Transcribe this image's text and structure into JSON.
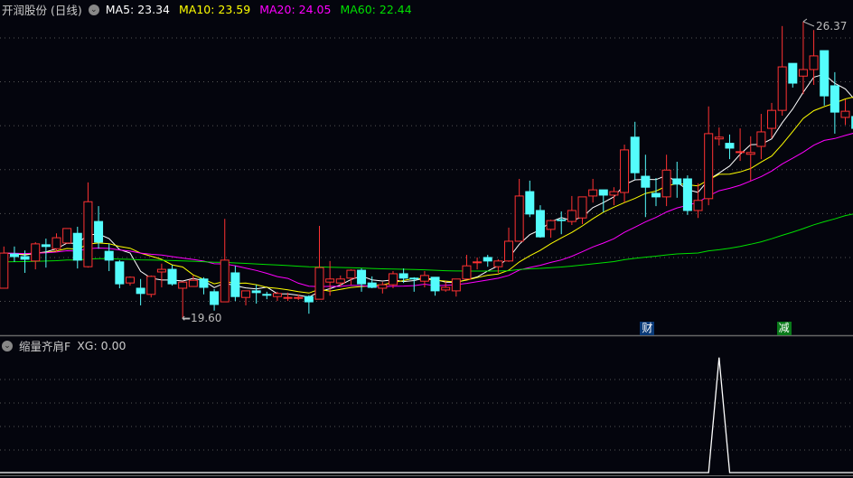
{
  "header": {
    "stock_name": "开润股份 (日线)",
    "ma_labels": [
      {
        "text": "MA5: 23.34",
        "color": "#ffffff"
      },
      {
        "text": "MA10: 23.59",
        "color": "#ffff00"
      },
      {
        "text": "MA20: 24.05",
        "color": "#ff00ff"
      },
      {
        "text": "MA60: 22.44",
        "color": "#00e000"
      }
    ]
  },
  "indicator": {
    "name": "缩量齐肩F",
    "value_label": "XG: 0.00"
  },
  "annotations": {
    "low_label": "←19.60",
    "high_label": "26.37",
    "event_tags": [
      {
        "text": "财",
        "index": 61,
        "color": "#0a3a78"
      },
      {
        "text": "减",
        "index": 74,
        "color": "#0a7a1a"
      }
    ]
  },
  "colors": {
    "up": "#ff3232",
    "down": "#54fcfc",
    "background": "#04050d",
    "grid": "#555555"
  },
  "chart_data": [
    {
      "type": "candlestick",
      "title": "开润股份 (日线)",
      "ylim": [
        19.4,
        27.0
      ],
      "grid": true,
      "ohlc": [
        [
          20.3,
          21.1,
          21.25,
          20.3
        ],
        [
          21.08,
          21.02,
          21.25,
          20.9
        ],
        [
          21.02,
          20.96,
          21.16,
          20.65
        ],
        [
          20.92,
          21.31,
          21.35,
          20.73
        ],
        [
          21.29,
          21.25,
          21.43,
          20.77
        ],
        [
          21.2,
          21.45,
          21.55,
          21.12
        ],
        [
          21.33,
          21.66,
          21.66,
          21.31
        ],
        [
          21.55,
          20.94,
          21.7,
          20.75
        ],
        [
          20.79,
          22.27,
          22.71,
          20.77
        ],
        [
          21.82,
          21.35,
          22.17,
          21.2
        ],
        [
          21.14,
          20.94,
          21.31,
          20.69
        ],
        [
          20.9,
          20.4,
          20.94,
          20.3
        ],
        [
          20.42,
          20.55,
          20.57,
          20.36
        ],
        [
          20.3,
          20.18,
          20.51,
          19.91
        ],
        [
          20.16,
          20.57,
          20.59,
          20.09
        ],
        [
          20.67,
          20.73,
          20.86,
          20.32
        ],
        [
          20.73,
          20.4,
          20.83,
          20.36
        ],
        [
          20.3,
          20.44,
          20.46,
          19.6
        ],
        [
          20.34,
          20.48,
          20.59,
          20.34
        ],
        [
          20.51,
          20.32,
          20.55,
          20.16
        ],
        [
          20.22,
          19.93,
          20.28,
          19.79
        ],
        [
          19.99,
          20.94,
          21.88,
          19.99
        ],
        [
          20.65,
          20.11,
          20.81,
          20.01
        ],
        [
          20.09,
          20.24,
          20.24,
          19.91
        ],
        [
          20.24,
          20.2,
          20.38,
          19.95
        ],
        [
          20.16,
          20.14,
          20.22,
          20.05
        ],
        [
          20.11,
          20.18,
          20.22,
          20.01
        ],
        [
          20.09,
          20.09,
          20.2,
          20.01
        ],
        [
          20.07,
          20.09,
          20.16,
          20.03
        ],
        [
          20.11,
          19.99,
          20.14,
          19.72
        ],
        [
          20.05,
          20.77,
          21.72,
          20.05
        ],
        [
          20.44,
          20.51,
          20.92,
          20.13
        ],
        [
          20.42,
          20.51,
          20.59,
          20.34
        ],
        [
          20.53,
          20.71,
          20.73,
          20.38
        ],
        [
          20.71,
          20.4,
          20.75,
          20.22
        ],
        [
          20.42,
          20.32,
          20.57,
          20.3
        ],
        [
          20.3,
          20.38,
          20.44,
          20.18
        ],
        [
          20.38,
          20.63,
          20.69,
          20.3
        ],
        [
          20.63,
          20.53,
          20.75,
          20.42
        ],
        [
          20.53,
          20.51,
          20.55,
          20.22
        ],
        [
          20.46,
          20.59,
          20.69,
          20.32
        ],
        [
          20.55,
          20.24,
          20.55,
          20.13
        ],
        [
          20.26,
          20.32,
          20.46,
          20.22
        ],
        [
          20.24,
          20.51,
          20.51,
          20.11
        ],
        [
          20.51,
          20.81,
          21.06,
          20.51
        ],
        [
          20.88,
          20.9,
          21.0,
          20.73
        ],
        [
          21.0,
          20.92,
          21.06,
          20.79
        ],
        [
          20.79,
          20.92,
          20.96,
          20.65
        ],
        [
          20.92,
          21.37,
          21.68,
          20.9
        ],
        [
          21.37,
          22.4,
          22.79,
          21.37
        ],
        [
          22.5,
          21.99,
          22.75,
          21.92
        ],
        [
          22.07,
          21.47,
          22.19,
          21.45
        ],
        [
          21.64,
          21.84,
          21.86,
          21.45
        ],
        [
          21.86,
          21.84,
          22.05,
          21.53
        ],
        [
          21.82,
          22.07,
          22.4,
          21.74
        ],
        [
          21.9,
          22.38,
          22.38,
          21.76
        ],
        [
          22.4,
          22.54,
          22.79,
          22.25
        ],
        [
          22.54,
          22.42,
          22.54,
          22.03
        ],
        [
          22.42,
          22.5,
          22.6,
          22.19
        ],
        [
          22.48,
          23.45,
          23.57,
          22.25
        ],
        [
          23.74,
          22.93,
          24.09,
          22.77
        ],
        [
          22.85,
          22.6,
          23.34,
          21.92
        ],
        [
          22.46,
          22.38,
          22.81,
          22.17
        ],
        [
          22.38,
          22.99,
          23.34,
          22.17
        ],
        [
          22.79,
          22.67,
          23.18,
          22.36
        ],
        [
          22.79,
          22.07,
          22.87,
          21.97
        ],
        [
          22.07,
          22.3,
          22.69,
          21.9
        ],
        [
          22.34,
          23.82,
          24.44,
          22.19
        ],
        [
          23.7,
          23.74,
          23.96,
          23.55
        ],
        [
          23.6,
          23.49,
          23.8,
          23.24
        ],
        [
          23.41,
          23.41,
          23.94,
          23.2
        ],
        [
          23.35,
          23.39,
          23.76,
          22.75
        ],
        [
          23.53,
          23.86,
          24.27,
          23.24
        ],
        [
          23.94,
          24.35,
          24.52,
          23.72
        ],
        [
          24.35,
          25.34,
          26.27,
          24.23
        ],
        [
          25.42,
          24.97,
          25.42,
          24.87
        ],
        [
          25.13,
          25.28,
          26.37,
          24.72
        ],
        [
          25.28,
          25.59,
          26.18,
          24.93
        ],
        [
          25.71,
          24.68,
          25.71,
          24.46
        ],
        [
          24.91,
          24.31,
          25.22,
          23.82
        ],
        [
          24.19,
          24.33,
          24.6,
          24.02
        ],
        [
          24.21,
          23.94,
          24.21,
          23.94
        ]
      ],
      "ma_periods": [
        5,
        10,
        20,
        60
      ],
      "ma_colors": [
        "#ffffff",
        "#ffff00",
        "#ff00ff",
        "#00e000"
      ],
      "ma60_seed": 20.9,
      "low": {
        "value": 19.6,
        "index": 17
      },
      "high": {
        "value": 26.37,
        "index": 76
      }
    },
    {
      "type": "line",
      "title": "缩量齐肩F",
      "series": [
        {
          "name": "XG",
          "spike_index": 68,
          "spike_value": 1,
          "base_value": 0
        }
      ],
      "ylim": [
        0,
        1.1
      ]
    }
  ]
}
